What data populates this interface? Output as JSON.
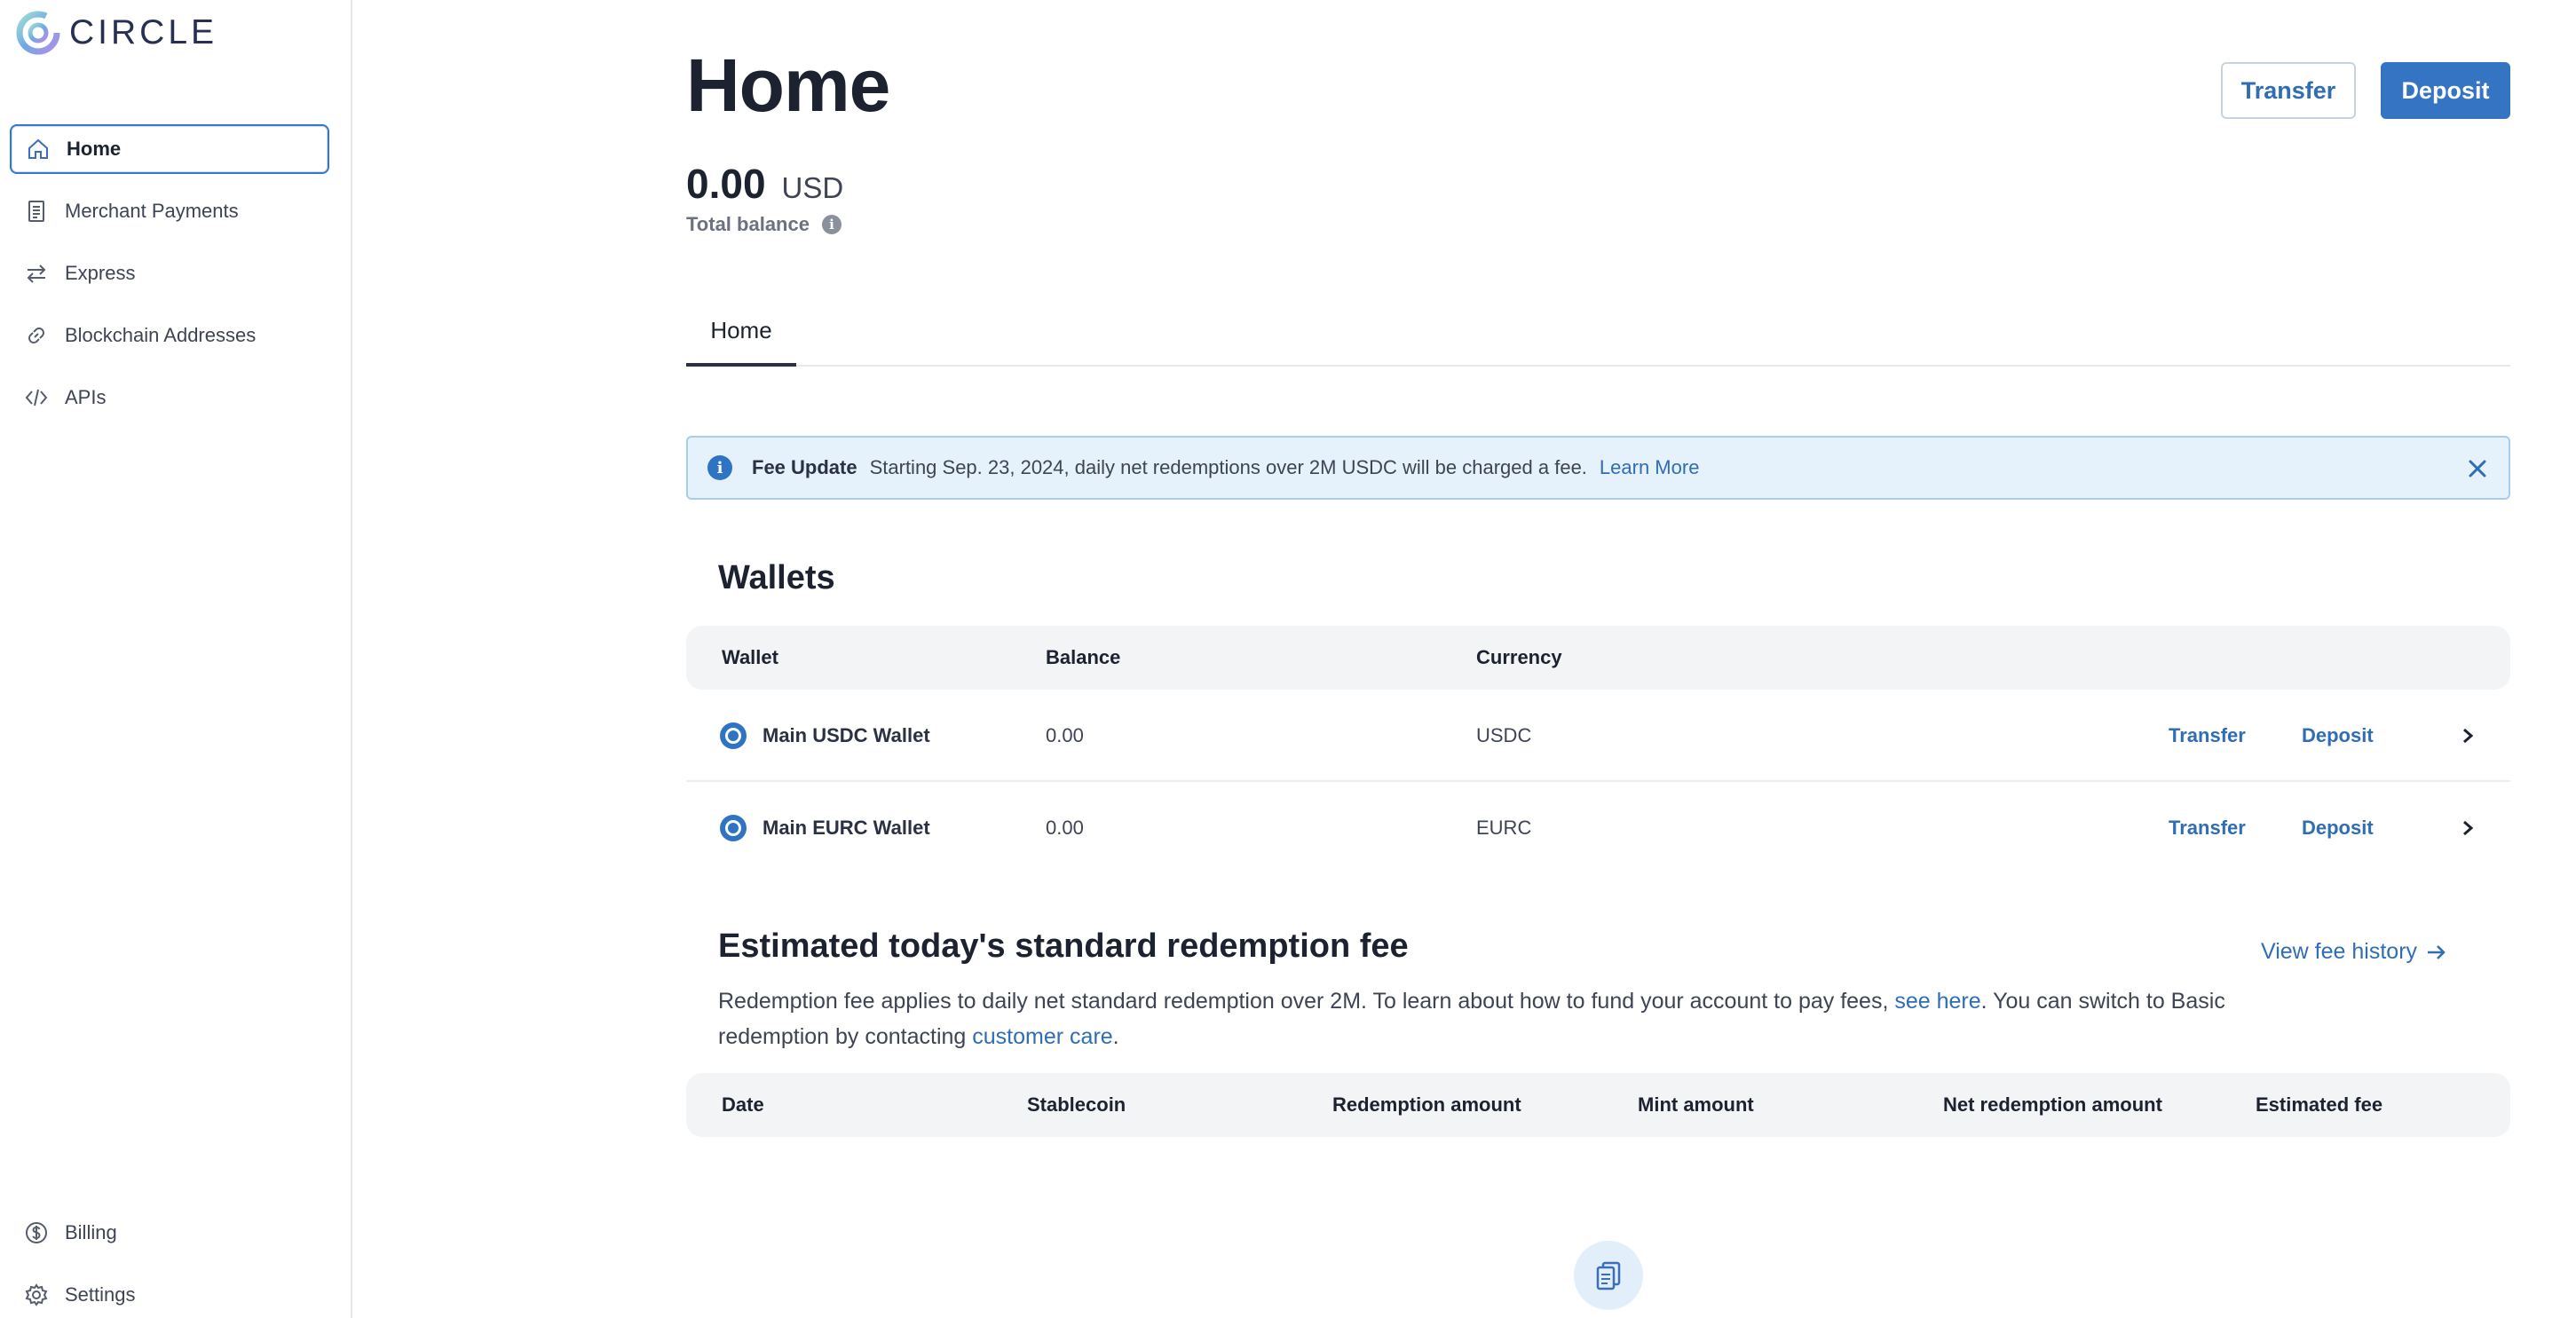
{
  "brand": {
    "name": "CIRCLE"
  },
  "sidebar": {
    "items": [
      {
        "label": "Home",
        "icon": "home-icon",
        "active": true
      },
      {
        "label": "Merchant Payments",
        "icon": "receipt-icon"
      },
      {
        "label": "Express",
        "icon": "arrows-swap-icon"
      },
      {
        "label": "Blockchain Addresses",
        "icon": "link-icon"
      },
      {
        "label": "APIs",
        "icon": "code-icon"
      }
    ],
    "bottom_items": [
      {
        "label": "Billing",
        "icon": "dollar-circle-icon"
      },
      {
        "label": "Settings",
        "icon": "gear-icon"
      }
    ]
  },
  "header": {
    "title": "Home",
    "transfer_label": "Transfer",
    "deposit_label": "Deposit"
  },
  "balance": {
    "amount": "0.00",
    "currency": "USD",
    "label": "Total balance"
  },
  "tabs": [
    {
      "label": "Home",
      "active": true
    }
  ],
  "banner": {
    "title": "Fee Update",
    "text": "Starting Sep. 23, 2024, daily net redemptions over 2M USDC will be charged a fee.",
    "link": "Learn More"
  },
  "wallets": {
    "title": "Wallets",
    "columns": [
      "Wallet",
      "Balance",
      "Currency"
    ],
    "rows": [
      {
        "name": "Main USDC Wallet",
        "balance": "0.00",
        "currency": "USDC",
        "transfer": "Transfer",
        "deposit": "Deposit"
      },
      {
        "name": "Main EURC Wallet",
        "balance": "0.00",
        "currency": "EURC",
        "transfer": "Transfer",
        "deposit": "Deposit"
      }
    ]
  },
  "fee": {
    "title": "Estimated today's standard redemption fee",
    "history_link": "View fee history",
    "desc_part1": "Redemption fee applies to daily net standard redemption over 2M. To learn about how to fund your account to pay fees, ",
    "desc_link1": "see here",
    "desc_part2": ". You can switch to Basic redemption by contacting ",
    "desc_link2": "customer care",
    "desc_part3": ".",
    "columns": [
      "Date",
      "Stablecoin",
      "Redemption amount",
      "Mint amount",
      "Net redemption amount",
      "Estimated fee"
    ]
  },
  "colors": {
    "accent": "#3574c2",
    "link": "#2f6db5",
    "banner_bg": "#e5f1fb",
    "banner_border": "#a9cdec",
    "table_head_bg": "#f3f4f6"
  }
}
